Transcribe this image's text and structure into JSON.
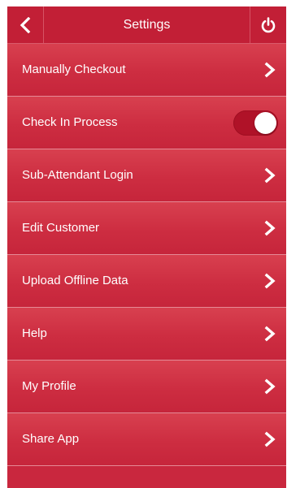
{
  "header": {
    "title": "Settings",
    "back_icon": "chevron-left-icon",
    "power_icon": "power-icon"
  },
  "items": [
    {
      "label": "Manually Checkout",
      "control": "chevron"
    },
    {
      "label": "Check In Process",
      "control": "toggle",
      "toggle_on": true
    },
    {
      "label": "Sub-Attendant Login",
      "control": "chevron"
    },
    {
      "label": "Edit Customer",
      "control": "chevron"
    },
    {
      "label": "Upload Offline Data",
      "control": "chevron"
    },
    {
      "label": "Help",
      "control": "chevron"
    },
    {
      "label": "My Profile",
      "control": "chevron"
    },
    {
      "label": "Share App",
      "control": "chevron"
    }
  ],
  "colors": {
    "background": "#c9273e",
    "header": "#c21f36",
    "divider": "#e58a96",
    "text": "#ffffff",
    "toggle_track": "#b01228"
  }
}
